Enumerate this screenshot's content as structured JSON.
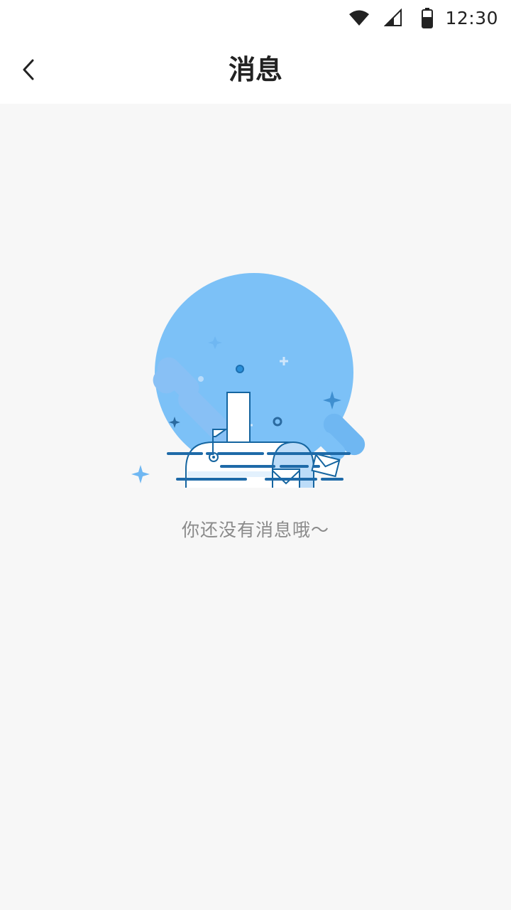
{
  "status_bar": {
    "time": "12:30",
    "icons": [
      "wifi-icon",
      "signal-icon",
      "battery-icon"
    ]
  },
  "header": {
    "title": "消息",
    "back_icon": "chevron-left-icon"
  },
  "empty_state": {
    "illustration": "mailbox-illustration",
    "message": "你还没有消息哦～"
  },
  "colors": {
    "background": "#f7f7f7",
    "header_bg": "#ffffff",
    "accent_blue": "#7cc1f7",
    "dark_blue": "#1565a0",
    "text_primary": "#222222",
    "text_secondary": "#8a8a8a"
  }
}
